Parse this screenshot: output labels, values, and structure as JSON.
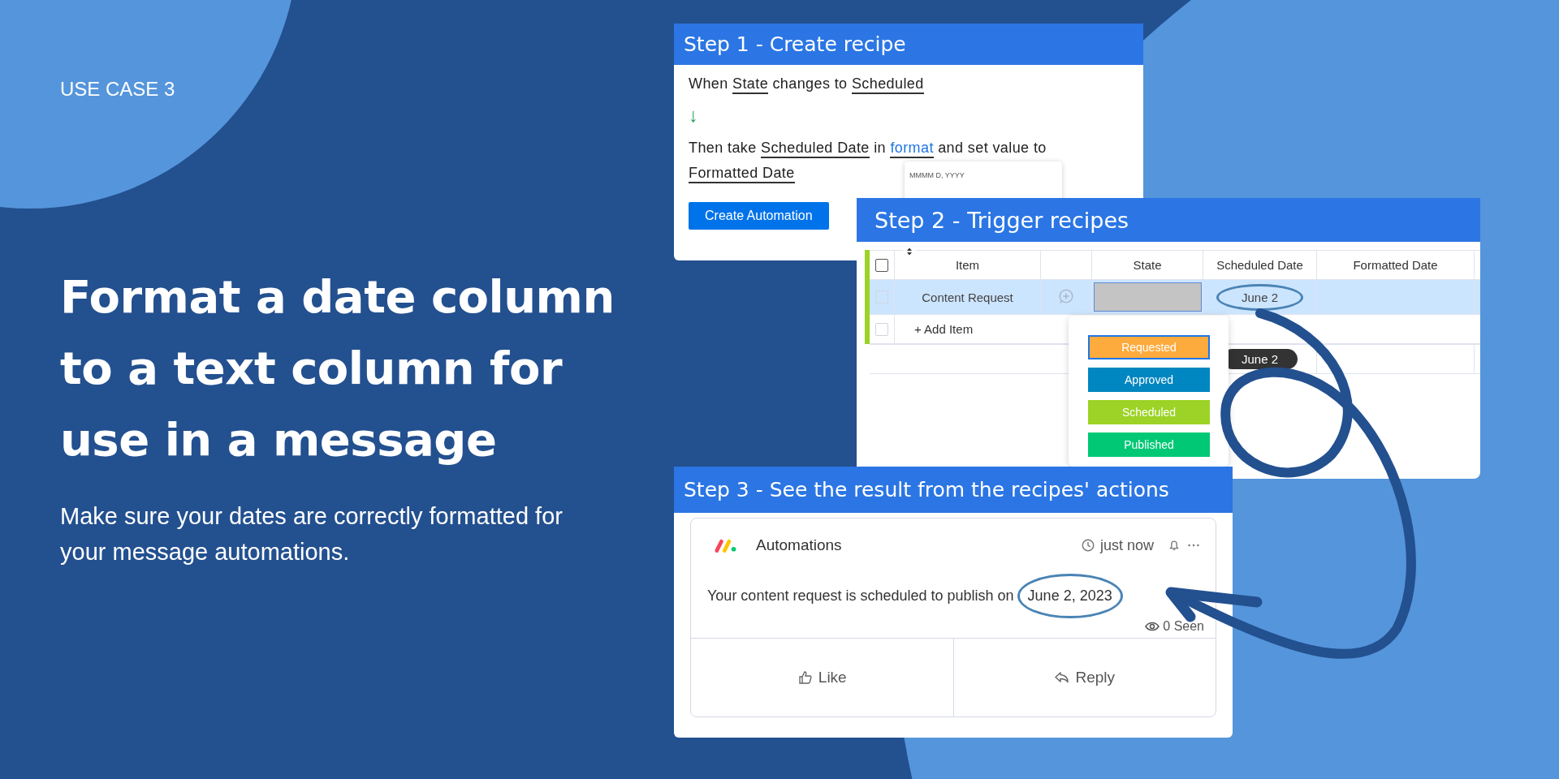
{
  "tagline": "USE CASE 3",
  "headline": "Format a date column to a text column for use in a message",
  "subtext": "Make sure your dates are correctly formatted for your message automations.",
  "step1": {
    "title": "Step 1 - Create recipe",
    "trigger": [
      {
        "kind": "plain",
        "text": "When "
      },
      {
        "kind": "field",
        "text": "State"
      },
      {
        "kind": "plain",
        "text": " changes to "
      },
      {
        "kind": "field",
        "text": "Scheduled"
      }
    ],
    "arrow": "↓",
    "action": [
      {
        "kind": "plain",
        "text": "Then take "
      },
      {
        "kind": "field",
        "text": "Scheduled Date"
      },
      {
        "kind": "plain",
        "text": " in "
      },
      {
        "kind": "link",
        "text": "format"
      },
      {
        "kind": "plain",
        "text": " and set value to "
      },
      {
        "kind": "field",
        "text": "Formatted Date"
      }
    ],
    "format_value": "MMMM D, YYYY",
    "button": "Create Automation"
  },
  "step2": {
    "title": "Step 2 - Trigger recipes",
    "columns": [
      "Item",
      "State",
      "Scheduled Date",
      "Formatted Date"
    ],
    "header_checked": false,
    "rows": [
      {
        "item": "Content Request",
        "checked": false,
        "scheduled": "June 2",
        "circled": true,
        "selected": true
      }
    ],
    "add_item": "+ Add Item",
    "add_item_checked": false,
    "date_pill": "June 2",
    "options": [
      {
        "label": "Requested",
        "color": "#fdab3d",
        "selected": true
      },
      {
        "label": "Approved",
        "color": "#0086c0",
        "selected": false
      },
      {
        "label": "Scheduled",
        "color": "#9cd326",
        "selected": false
      },
      {
        "label": "Published",
        "color": "#00c875",
        "selected": false
      }
    ]
  },
  "step3": {
    "title": "Step 3 - See the result from the recipes' actions",
    "sender": "Automations",
    "time": "just now",
    "message": "Your content request is scheduled to publish on",
    "message_date": "June 2, 2023",
    "seen": "0 Seen",
    "like": "Like",
    "reply": "Reply"
  }
}
